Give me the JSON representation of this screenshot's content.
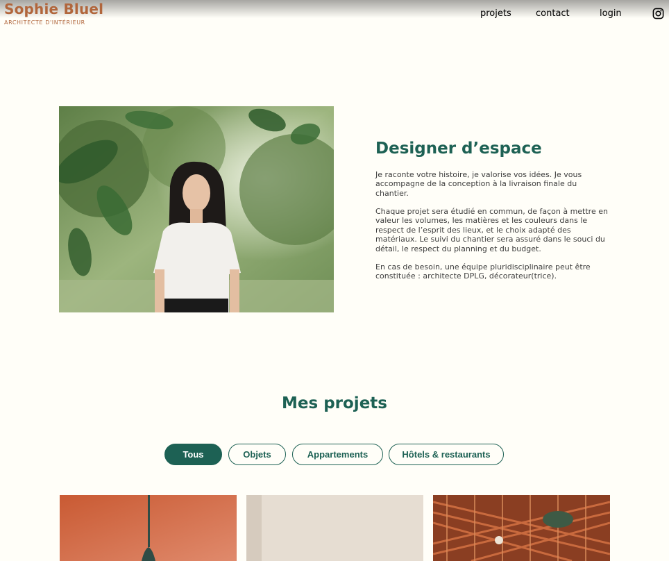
{
  "header": {
    "brand_name": "Sophie Bluel",
    "brand_subtitle": "ARCHITECTE D'INTÉRIEUR",
    "nav": {
      "projets": "projets",
      "contact": "contact",
      "login": "login"
    },
    "instagram_icon": "instagram-icon"
  },
  "intro": {
    "title": "Designer d’espace",
    "paragraphs": [
      "Je raconte votre histoire, je valorise vos idées. Je vous accompagne de la conception à la livraison finale du chantier.",
      "Chaque projet sera étudié en commun, de façon à mettre en valeur les volumes, les matières et les couleurs dans le respect de l’esprit des lieux, et le choix adapté des matériaux. Le suivi du chantier sera assuré dans le souci du détail, le respect du planning et du budget.",
      "En cas de besoin, une équipe pluridisciplinaire peut être constituée : architecte DPLG, décorateur(trice)."
    ]
  },
  "projects": {
    "title": "Mes projets",
    "filters": [
      "Tous",
      "Objets",
      "Appartements",
      "Hôtels & restaurants"
    ],
    "active_filter": "Tous"
  },
  "colors": {
    "brand": "#B1663C",
    "accent": "#1D6154",
    "background": "#FFFEF8"
  }
}
